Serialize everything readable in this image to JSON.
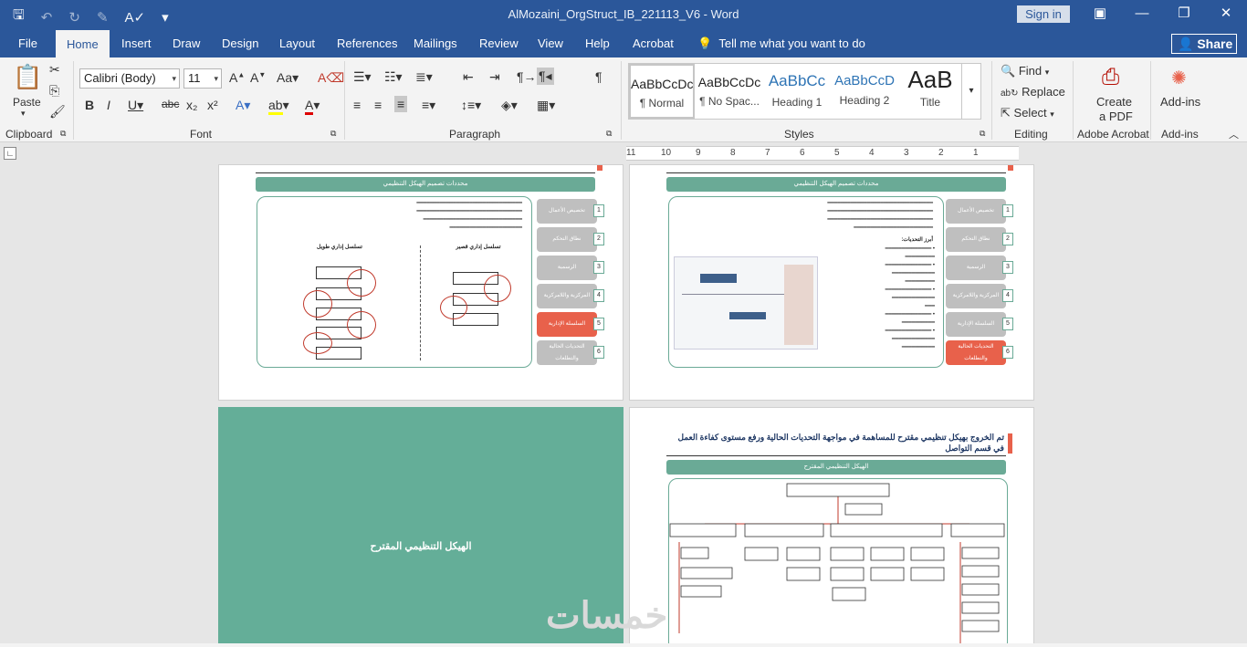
{
  "app": {
    "title": "AlMozaini_OrgStruct_IB_221113_V6  -  Word",
    "signin": "Sign in"
  },
  "tabs": [
    "File",
    "Home",
    "Insert",
    "Draw",
    "Design",
    "Layout",
    "References",
    "Mailings",
    "Review",
    "View",
    "Help",
    "Acrobat"
  ],
  "tellme": "Tell me what you want to do",
  "share": "Share",
  "ribbon": {
    "clipboard": {
      "label": "Clipboard",
      "paste": "Paste"
    },
    "font": {
      "label": "Font",
      "name": "Calibri (Body)",
      "size": "11"
    },
    "paragraph": {
      "label": "Paragraph"
    },
    "styles": {
      "label": "Styles",
      "items": [
        {
          "preview": "AaBbCcDc",
          "name": "¶ Normal"
        },
        {
          "preview": "AaBbCcDc",
          "name": "¶ No Spac..."
        },
        {
          "preview": "AaBbCc",
          "name": "Heading 1"
        },
        {
          "preview": "AaBbCcD",
          "name": "Heading 2"
        },
        {
          "preview": "AaB",
          "name": "Title"
        }
      ]
    },
    "editing": {
      "label": "Editing",
      "find": "Find",
      "replace": "Replace",
      "select": "Select"
    },
    "acrobat": {
      "label": "Adobe Acrobat",
      "create": "Create",
      "pdf": "a PDF"
    },
    "addins": {
      "label": "Add-ins",
      "button": "Add-ins"
    }
  },
  "ruler": [
    "11",
    "10",
    "9",
    "8",
    "7",
    "6",
    "5",
    "4",
    "3",
    "2",
    "1"
  ],
  "pages": {
    "header": "محددات تصميم الهيكل التنظيمي",
    "side_items_left": [
      "تخصيص الأعمال",
      "نطاق التحكم",
      "الرسمية",
      "المركزية واللامركزية",
      "السلسلة الإدارية",
      "التحديات الحالية والتطلعات"
    ],
    "side_items_right": [
      "تخصيص الأعمال",
      "نطاق التحكم",
      "الرسمية",
      "المركزية واللامركزية",
      "السلسلة الإدارية",
      "التحديات الحالية والتطلعات"
    ],
    "numbers": [
      "1",
      "2",
      "3",
      "4",
      "5",
      "6"
    ],
    "chain_long": "تسلسل إداري طويل",
    "chain_short": "تسلسل إداري قصير",
    "challenges": "أبرز التحديات:",
    "proposed_title": "تم الخروج بهيكل تنظيمي مقترح للمساهمة في مواجهة التحديات الحالية ورفع مستوى كفاءة العمل في قسم التواصل",
    "proposed_header": "الهيكل التنظيمي المقترح",
    "green_page": "الهيكل التنظيمي المقترح",
    "watermark": "خمسات"
  }
}
